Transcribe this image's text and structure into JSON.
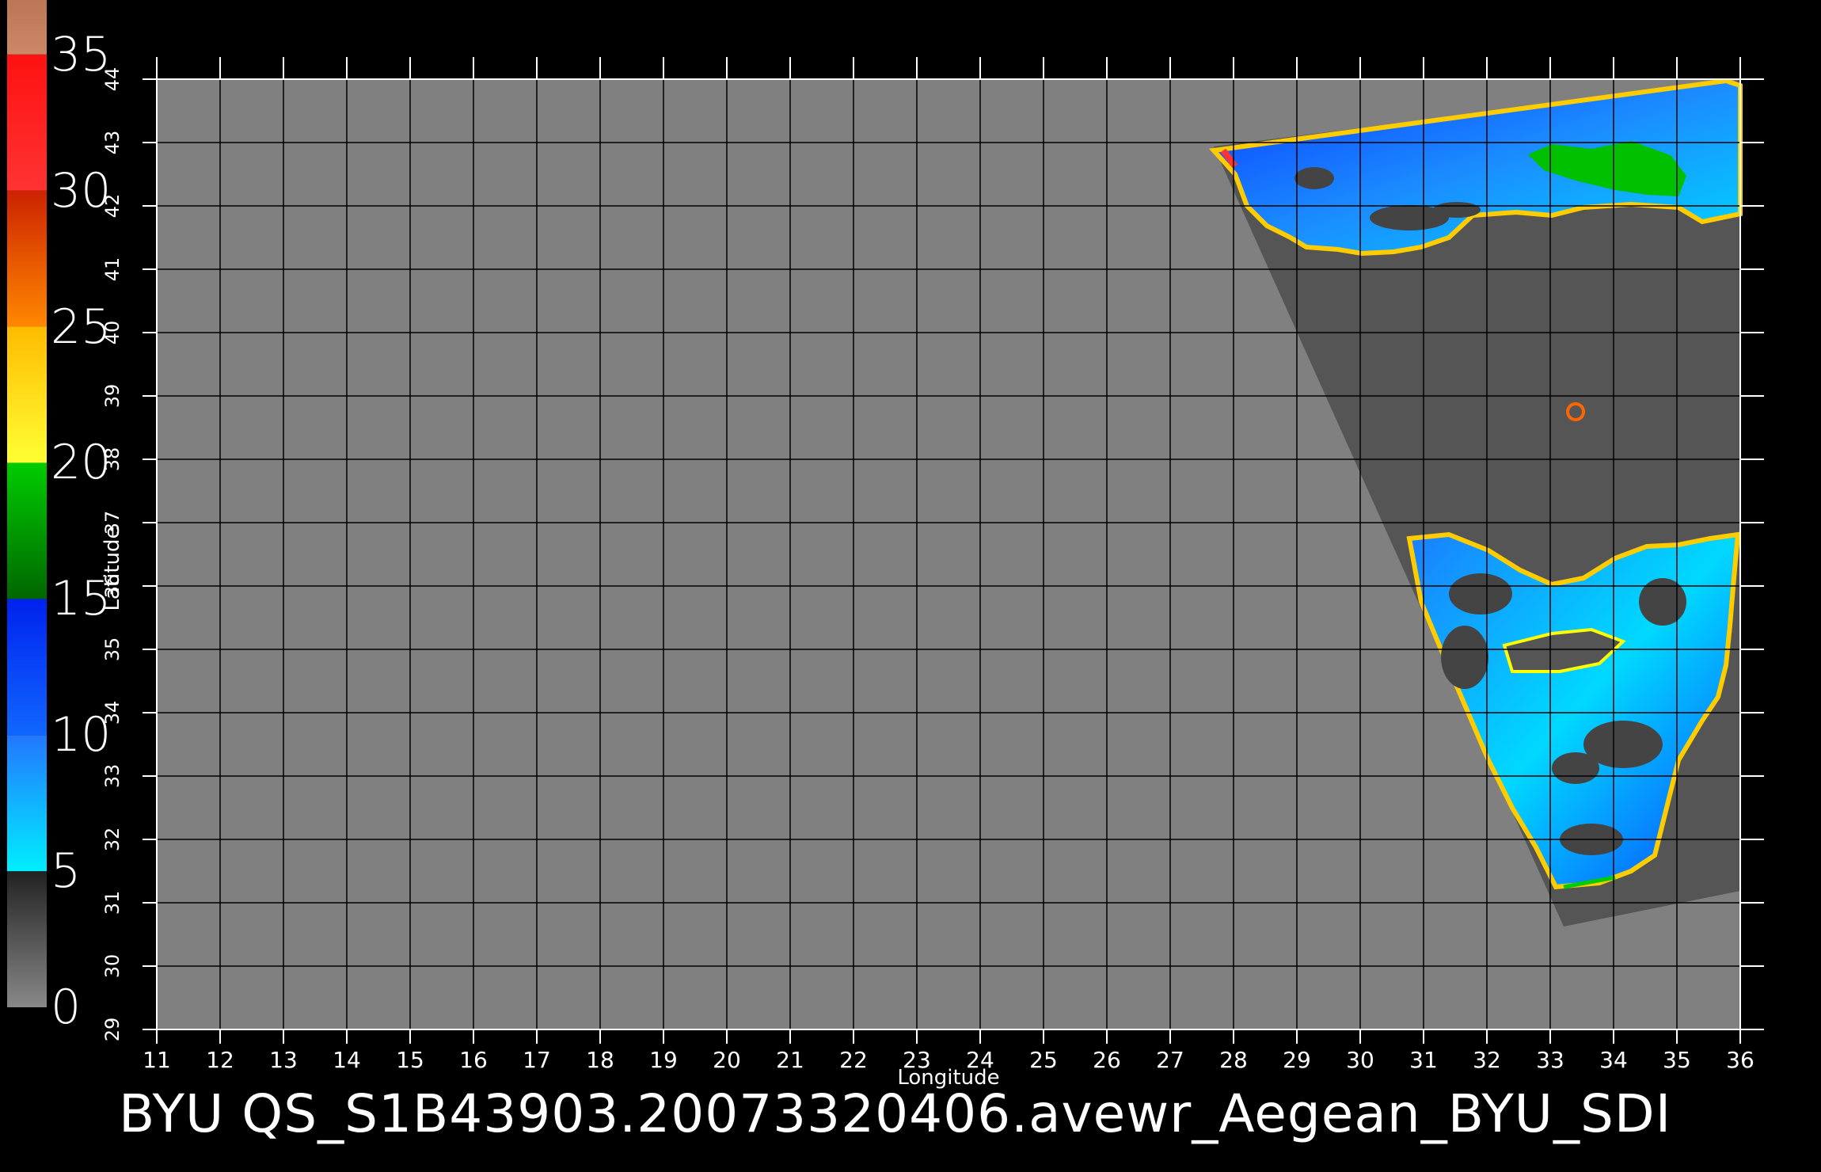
{
  "title": "BYU  QS_S1B43903.20073320406.avewr_Aegean_BYU_SDI",
  "colorbar": {
    "tick_labels": [
      "35",
      "30",
      "25",
      "20",
      "15",
      "10",
      "5",
      "0"
    ],
    "segments": [
      {
        "from": 0,
        "to": 5,
        "color_top": "#222222",
        "color_bottom": "#888888"
      },
      {
        "from": 5,
        "to": 10,
        "color_top": "#2277ff",
        "color_bottom": "#00eeff"
      },
      {
        "from": 10,
        "to": 15,
        "color_top": "#0022ee",
        "color_bottom": "#1166ff"
      },
      {
        "from": 15,
        "to": 20,
        "color_top": "#00cc00",
        "color_bottom": "#006600"
      },
      {
        "from": 20,
        "to": 25,
        "color_top": "#ffbb00",
        "color_bottom": "#ffff33"
      },
      {
        "from": 25,
        "to": 30,
        "color_top": "#cc2200",
        "color_bottom": "#ff8800"
      },
      {
        "from": 30,
        "to": 35,
        "color_top": "#ff1111",
        "color_bottom": "#ff3333"
      },
      {
        "from": 35,
        "to": 37,
        "color_top": "#bb7755",
        "color_bottom": "#cc8866"
      }
    ]
  },
  "axes": {
    "xlabel": "Longitude",
    "ylabel": "Latitude",
    "x_ticks": [
      "11",
      "12",
      "13",
      "14",
      "15",
      "16",
      "17",
      "18",
      "19",
      "20",
      "21",
      "22",
      "23",
      "24",
      "25",
      "26",
      "27",
      "28",
      "29",
      "30",
      "31",
      "32",
      "33",
      "34",
      "35",
      "36"
    ],
    "y_ticks": [
      "29",
      "30",
      "31",
      "32",
      "33",
      "34",
      "35",
      "36",
      "37",
      "38",
      "39",
      "40",
      "41",
      "42",
      "43",
      "44"
    ],
    "x_range": [
      11,
      36
    ],
    "y_range": [
      29,
      44
    ]
  },
  "colors": {
    "background": "#000000",
    "land": "#808080",
    "swath_nodata": "#555555",
    "grid": "#000000"
  }
}
